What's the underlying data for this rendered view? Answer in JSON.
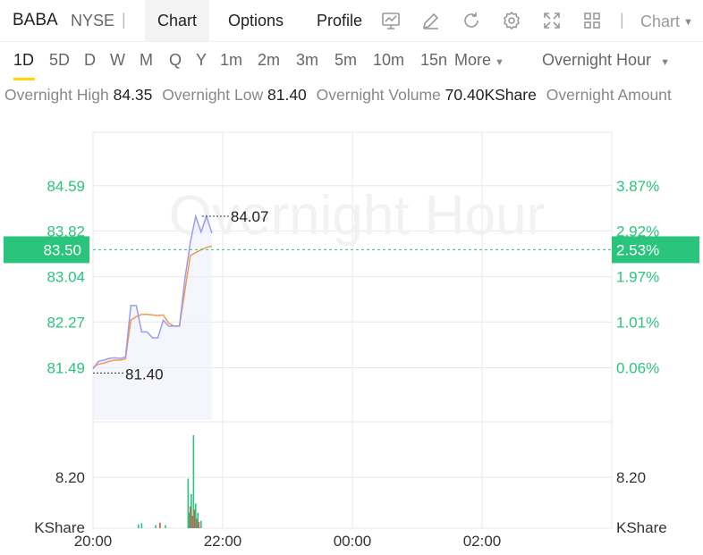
{
  "header": {
    "ticker": "BABA",
    "exchange": "NYSE",
    "separator": "|",
    "tabs": [
      {
        "label": "Chart",
        "active": true
      },
      {
        "label": "Options",
        "active": false
      },
      {
        "label": "Profile",
        "active": false
      }
    ],
    "icons": [
      "chart-indicator-icon",
      "draw-pencil-icon",
      "refresh-icon",
      "settings-gear-icon",
      "fullscreen-icon",
      "grid-layout-icon"
    ],
    "chart_menu": "Chart"
  },
  "periods": {
    "items": [
      "1D",
      "5D",
      "D",
      "W",
      "M",
      "Q",
      "Y",
      "1m",
      "2m",
      "3m",
      "5m",
      "10m",
      "15n"
    ],
    "active": "1D",
    "more_label": "More",
    "session_label": "Overnight Hour"
  },
  "stats": {
    "high_label": "Overnight High",
    "high_value": "84.35",
    "low_label": "Overnight Low",
    "low_value": "81.40",
    "volume_label": "Overnight Volume",
    "volume_value": "70.40KShare",
    "amount_label": "Overnight Amount"
  },
  "colors": {
    "up": "#2bc47d",
    "down": "#e84c4c",
    "price_line": "#9a9cf0",
    "avg_line": "#f29a4e",
    "grid": "#e8e8e8"
  },
  "chart_data": {
    "type": "line",
    "watermark": "Overnight Hour",
    "x_ticks": [
      "20:00",
      "22:00",
      "00:00",
      "02:00"
    ],
    "y_ticks": [
      81.49,
      82.27,
      83.04,
      83.82,
      84.59
    ],
    "pct_ticks": [
      "0.06%",
      "1.01%",
      "1.97%",
      "2.92%",
      "3.87%"
    ],
    "ylim": [
      80.6,
      85.5
    ],
    "current_price": "83.50",
    "current_pct": "2.53%",
    "high_label": "84.07",
    "low_label": "81.40",
    "volume_tick": "8.20",
    "volume_unit": "KShare",
    "series": [
      {
        "kind": "price",
        "x": [
          "20:00",
          "20:05",
          "20:10",
          "20:15",
          "20:20",
          "20:25",
          "20:30",
          "20:35",
          "20:40",
          "20:45",
          "20:50",
          "20:55",
          "21:00",
          "21:05",
          "21:10",
          "21:15",
          "21:20",
          "21:25",
          "21:30",
          "21:35",
          "21:40",
          "21:45",
          "21:50"
        ],
        "values": [
          81.47,
          81.6,
          81.62,
          81.65,
          81.66,
          81.65,
          81.67,
          82.55,
          82.55,
          82.1,
          82.1,
          82.0,
          82.0,
          82.3,
          82.2,
          82.2,
          82.2,
          83.0,
          83.62,
          84.07,
          83.8,
          84.07,
          83.78
        ]
      },
      {
        "kind": "average",
        "x": [
          "20:00",
          "20:05",
          "20:10",
          "20:15",
          "20:20",
          "20:25",
          "20:30",
          "20:35",
          "20:40",
          "20:45",
          "20:50",
          "20:55",
          "21:00",
          "21:05",
          "21:10",
          "21:15",
          "21:20",
          "21:25",
          "21:30",
          "21:35",
          "21:40",
          "21:45",
          "21:50"
        ],
        "values": [
          81.5,
          81.55,
          81.57,
          81.6,
          81.62,
          81.62,
          81.64,
          82.3,
          82.36,
          82.4,
          82.4,
          82.39,
          82.38,
          82.39,
          82.25,
          82.2,
          82.2,
          82.8,
          83.4,
          83.45,
          83.5,
          83.54,
          83.56
        ]
      }
    ],
    "volume": {
      "max": 16,
      "bars": [
        {
          "x": "20:42",
          "v": 0.6,
          "up": true
        },
        {
          "x": "20:45",
          "v": 0.8,
          "up": true
        },
        {
          "x": "20:58",
          "v": 0.5,
          "up": true
        },
        {
          "x": "21:02",
          "v": 0.9,
          "up": false
        },
        {
          "x": "21:07",
          "v": 0.5,
          "up": true
        },
        {
          "x": "21:28",
          "v": 8.0,
          "up": true
        },
        {
          "x": "21:29",
          "v": 2.5,
          "up": true
        },
        {
          "x": "21:30",
          "v": 3.5,
          "up": false
        },
        {
          "x": "21:31",
          "v": 5.5,
          "up": true
        },
        {
          "x": "21:32",
          "v": 2.0,
          "up": false
        },
        {
          "x": "21:33",
          "v": 15.0,
          "up": true
        },
        {
          "x": "21:34",
          "v": 3.0,
          "up": false
        },
        {
          "x": "21:35",
          "v": 4.0,
          "up": true
        },
        {
          "x": "21:36",
          "v": 1.5,
          "up": false
        },
        {
          "x": "21:37",
          "v": 2.5,
          "up": true
        },
        {
          "x": "21:38",
          "v": 1.0,
          "up": false
        },
        {
          "x": "21:40",
          "v": 1.2,
          "up": true
        }
      ]
    }
  }
}
